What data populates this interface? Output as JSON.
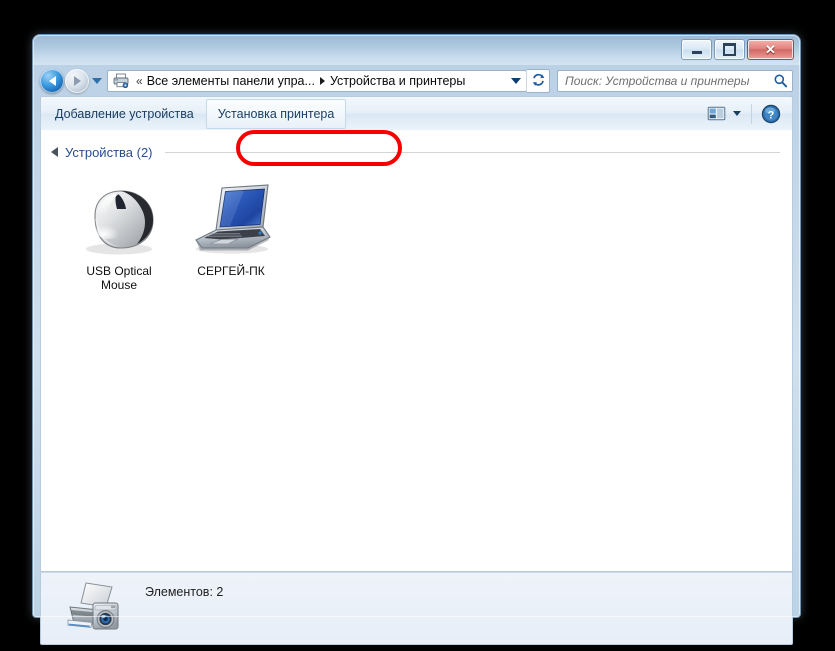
{
  "window": {
    "title": "",
    "controls": {
      "minimize_label": "Свернуть",
      "maximize_label": "Развернуть",
      "close_label": "Закрыть",
      "close_glyph": "✕"
    }
  },
  "nav": {
    "back_label": "Назад",
    "forward_label": "Вперед",
    "recent_pages_label": "Последние страницы",
    "refresh_label": "Обновить",
    "breadcrumb_icon": "printer-icon",
    "breadcrumb_overflow": "«",
    "breadcrumbs": [
      "Все элементы панели упра...",
      "Устройства и принтеры"
    ]
  },
  "search": {
    "placeholder": "Поиск: Устройства и принтеры",
    "value": "",
    "icon": "search-icon"
  },
  "toolbar": {
    "items": [
      {
        "label": "Добавление устройства",
        "hovered": false
      },
      {
        "label": "Установка принтера",
        "hovered": true
      }
    ],
    "view_icon": "view-layout-icon",
    "view_dropdown": "chevron-down-icon",
    "help_icon": "help-question-icon",
    "help_label": "Справка"
  },
  "content": {
    "group": {
      "title": "Устройства (2)",
      "count": 2,
      "collapse_icon": "triangle-collapse-icon"
    },
    "devices": [
      {
        "label": "USB Optical Mouse",
        "icon": "mouse-icon"
      },
      {
        "label": "СЕРГЕЙ-ПК",
        "icon": "laptop-icon"
      }
    ]
  },
  "statusbar": {
    "icon": "printer-scanner-camera-icon",
    "text": "Элементов: 2"
  },
  "annotation": {
    "highlight_color": "#f70000",
    "target": "Установка принтера"
  },
  "colors": {
    "desktop_background": "#000000",
    "window_frame": "#bcd3e6",
    "content_background": "#ffffff",
    "group_title": "#2a4d8f",
    "toolbar_text": "#1b3f63",
    "accent_blue": "#1563ad"
  }
}
